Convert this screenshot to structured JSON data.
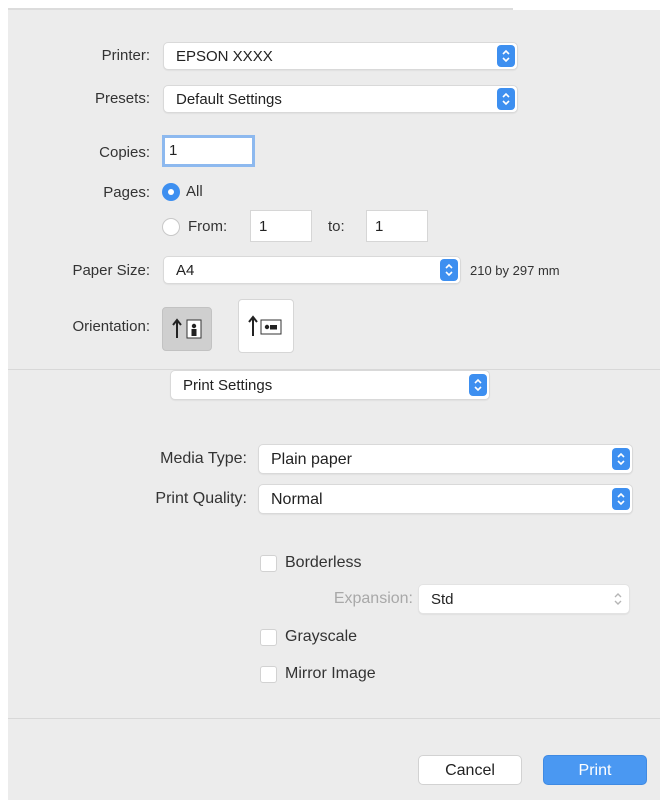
{
  "printer": {
    "label": "Printer:",
    "value": "EPSON XXXX"
  },
  "presets": {
    "label": "Presets:",
    "value": "Default Settings"
  },
  "copies": {
    "label": "Copies:",
    "value": "1"
  },
  "pages": {
    "label": "Pages:",
    "all_label": "All",
    "from_label": "From:",
    "from_value": "1",
    "to_label": "to:",
    "to_value": "1",
    "selected": "All"
  },
  "paper_size": {
    "label": "Paper Size:",
    "value": "A4",
    "dimensions": "210 by 297 mm"
  },
  "orientation": {
    "label": "Orientation:",
    "selected": "portrait"
  },
  "section_popup": {
    "value": "Print Settings"
  },
  "media_type": {
    "label": "Media Type:",
    "value": "Plain paper"
  },
  "print_quality": {
    "label": "Print Quality:",
    "value": "Normal"
  },
  "options": {
    "borderless": {
      "label": "Borderless",
      "checked": false
    },
    "expansion": {
      "label": "Expansion:",
      "value": "Std",
      "enabled": false
    },
    "grayscale": {
      "label": "Grayscale",
      "checked": false
    },
    "mirror": {
      "label": "Mirror Image",
      "checked": false
    }
  },
  "buttons": {
    "cancel": "Cancel",
    "print": "Print"
  },
  "colors": {
    "accent": "#3d8ff0",
    "dialog_bg": "#ececec"
  }
}
